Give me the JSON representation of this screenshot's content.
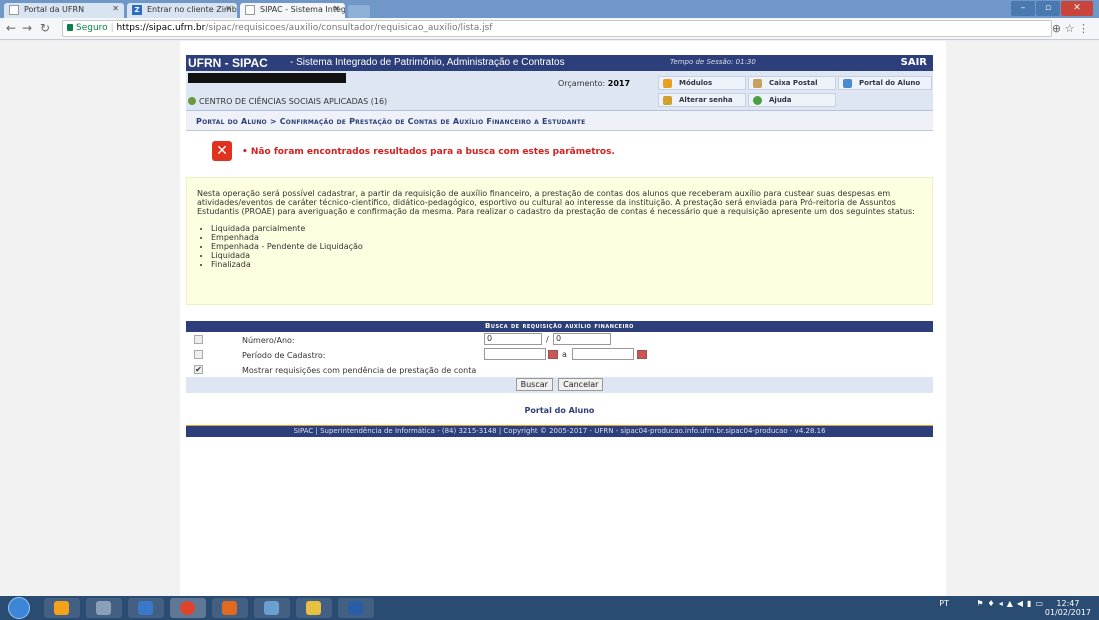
{
  "browser": {
    "tabs": [
      {
        "label": "Portal da UFRN"
      },
      {
        "label": "Entrar no cliente Zimbra"
      },
      {
        "label": "SIPAC - Sistema Integrad"
      }
    ],
    "url": {
      "secure_label": "Seguro",
      "host": "https://sipac.ufrn.br",
      "path": "/sipac/requisicoes/auxilio/consultador/requisicao_auxilio/lista.jsf"
    }
  },
  "header": {
    "system": "UFRN - SIPAC",
    "subtitle": "- Sistema Integrado de Patrimônio, Administração e Contratos",
    "session": "Tempo de Sessão: 01:30",
    "logout": "SAIR",
    "budget_label": "Orçamento:",
    "budget_year": "2017",
    "unit": "CENTRO DE CIÊNCIAS SOCIAIS APLICADAS (16)",
    "menu": {
      "modulos": "Módulos",
      "caixa_postal": "Caixa Postal",
      "portal_aluno": "Portal do Aluno",
      "alterar_senha": "Alterar senha",
      "ajuda": "Ajuda"
    }
  },
  "breadcrumb": "Portal do Aluno > Confirmação de Prestação de Contas de Auxílio Financeiro a Estudante",
  "error_message": "Não foram encontrados resultados para a busca com estes parâmetros.",
  "description": {
    "text": "Nesta operação será possível cadastrar, a partir da requisição de auxílio financeiro, a prestação de contas dos alunos que receberam auxílio para custear suas despesas em atividades/eventos de caráter técnico-científico, didático-pedagógico, esportivo ou cultural ao interesse da instituição. A prestação será enviada para Pró-reitoria de Assuntos Estudantis (PROAE) para averiguação e confirmação da mesma. Para realizar o cadastro da prestação de contas é necessário que a requisição apresente um dos seguintes status:",
    "statuses": [
      "Liquidada parcialmente",
      "Empenhada",
      "Empenhada - Pendente de Liquidação",
      "Liquidada",
      "Finalizada"
    ]
  },
  "form": {
    "title": "Busca de requisição auxílio financeiro",
    "numero_label": "Número/Ano:",
    "numero_value": "0",
    "ano_value": "0",
    "numero_sep": "/",
    "periodo_label": "Período de Cadastro:",
    "periodo_sep": "a",
    "pendencia_label": "Mostrar requisições com pendência de prestação de conta",
    "pendencia_checked": true,
    "search_button": "Buscar",
    "cancel_button": "Cancelar"
  },
  "portal_link": "Portal do Aluno",
  "footer": "SIPAC | Superintendência de Informática - (84) 3215-3148 | Copyright © 2005-2017 - UFRN - sipac04-producao.info.ufrn.br.sipac04-producao - v4.28.16",
  "taskbar": {
    "lang": "PT",
    "time": "12:47",
    "date": "01/02/2017"
  }
}
